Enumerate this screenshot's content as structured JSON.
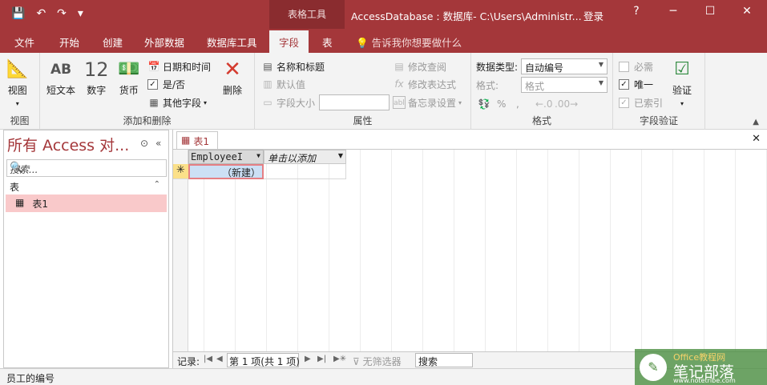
{
  "titlebar": {
    "save_icon": "save-icon",
    "undo": "↶",
    "redo": "↷",
    "customize": "▾",
    "context_tab": "表格工具",
    "title": "AccessDatabase : 数据库- C:\\Users\\Administr...",
    "login": "登录",
    "help": "?",
    "minimize": "─",
    "maximize": "☐",
    "close": "✕"
  },
  "tabs": {
    "file": "文件",
    "home": "开始",
    "create": "创建",
    "external": "外部数据",
    "dbtools": "数据库工具",
    "fields": "字段",
    "table": "表",
    "tellme": "告诉我你想要做什么"
  },
  "ribbon": {
    "views": {
      "view_label": "视图",
      "group": "视图"
    },
    "add_delete": {
      "short_text": "短文本",
      "number": "数字",
      "currency": "货币",
      "datetime": "日期和时间",
      "yesno": "是/否",
      "more_fields": "其他字段",
      "delete": "删除",
      "group": "添加和删除"
    },
    "properties": {
      "name_caption": "名称和标题",
      "default_value": "默认值",
      "field_size": "字段大小",
      "modify_lookups": "修改查阅",
      "modify_expression": "修改表达式",
      "memo_settings": "备忘录设置",
      "group": "属性"
    },
    "formatting": {
      "data_type_label": "数据类型:",
      "data_type_value": "自动编号",
      "format_label": "格式:",
      "format_value": "格式",
      "percent": "%",
      "comma": ",",
      "group": "格式"
    },
    "validation": {
      "required": "必需",
      "unique": "唯一",
      "indexed": "已索引",
      "validate": "验证",
      "group": "字段验证"
    }
  },
  "nav": {
    "title": "所有 Access 对...",
    "search_placeholder": "搜索...",
    "section": "表",
    "items": [
      {
        "label": "表1"
      }
    ]
  },
  "doc": {
    "tab_label": "表1",
    "columns": [
      "EmployeeI",
      "单击以添加"
    ],
    "new_record": "（新建）",
    "new_row_marker": "✳"
  },
  "recordbar": {
    "label": "记录:",
    "position": "第 1 项(共 1 项)",
    "filter": "无筛选器",
    "search": "搜索"
  },
  "status": "员工的编号",
  "watermark": {
    "t1": "Office教程网",
    "t2": "笔记部落",
    "t3": "www.notetribe.com"
  }
}
